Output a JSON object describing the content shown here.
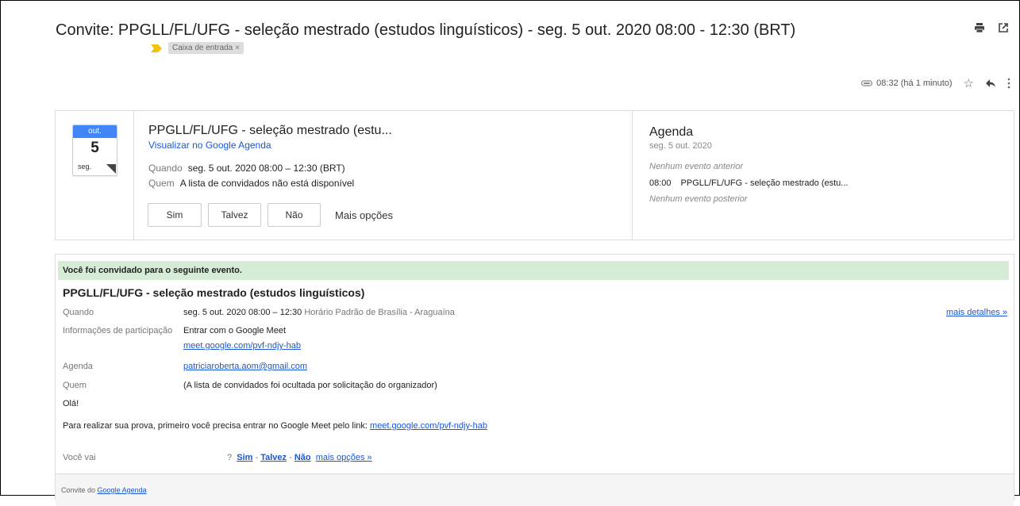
{
  "email": {
    "subject": "Convite: PPGLL/FL/UFG - seleção mestrado (estudos linguísticos) - seg. 5 out. 2020 08:00 - 12:30 (BRT)",
    "label": "Caixa de entrada",
    "label_close": "×",
    "time": "08:32 (há 1 minuto)",
    "icons": [
      "printer-icon",
      "external-window-icon",
      "attachment-icon",
      "star-icon",
      "reply-icon",
      "more-vert-icon"
    ]
  },
  "invite": {
    "calendar": {
      "month": "out.",
      "day": "5",
      "weekday": "seg."
    },
    "title": "PPGLL/FL/UFG - seleção mestrado (estu...",
    "view_link": "Visualizar no Google Agenda",
    "when_label": "Quando",
    "when_value": "seg. 5 out. 2020 08:00 – 12:30 (BRT)",
    "who_label": "Quem",
    "who_value": "A lista de convidados não está disponível",
    "buttons": {
      "yes": "Sim",
      "maybe": "Talvez",
      "no": "Não",
      "more": "Mais opções"
    }
  },
  "agenda": {
    "title": "Agenda",
    "date": "seg. 5 out. 2020",
    "no_prev": "Nenhum evento anterior",
    "event_time": "08:00",
    "event_title": "PPGLL/FL/UFG - seleção mestrado (estu...",
    "no_next": "Nenhum evento posterior"
  },
  "body": {
    "banner": "Você foi convidado para o seguinte evento.",
    "title": "PPGLL/FL/UFG - seleção mestrado (estudos linguísticos)",
    "when_label": "Quando",
    "when_value": "seg. 5 out. 2020 08:00 – 12:30",
    "when_tz": "Horário Padrão de Brasília - Araguaína",
    "more_details": "mais detalhes »",
    "join_label": "Informações de participação",
    "join_value": "Entrar com o Google Meet",
    "meet_link": "meet.google.com/pvf-ndjy-hab",
    "calendar_label": "Agenda",
    "calendar_value": "patriciaroberta.aom@gmail.com",
    "who_label": "Quem",
    "who_value": "(A lista de convidados foi ocultada por solicitação do organizador)",
    "greeting": "Olá!",
    "instructions": "Para realizar sua prova, primeiro você precisa entrar no Google Meet pelo link:",
    "instructions_link": "meet.google.com/pvf-ndjy-hab",
    "rsvp_label": "Você vai",
    "rsvp_q": "?",
    "rsvp_yes": "Sim",
    "rsvp_maybe": "Talvez",
    "rsvp_no": "Não",
    "rsvp_more": "mais opções »",
    "rsvp_sep": "-",
    "footer_prefix": "Convite do",
    "footer_link": "Google Agenda"
  }
}
